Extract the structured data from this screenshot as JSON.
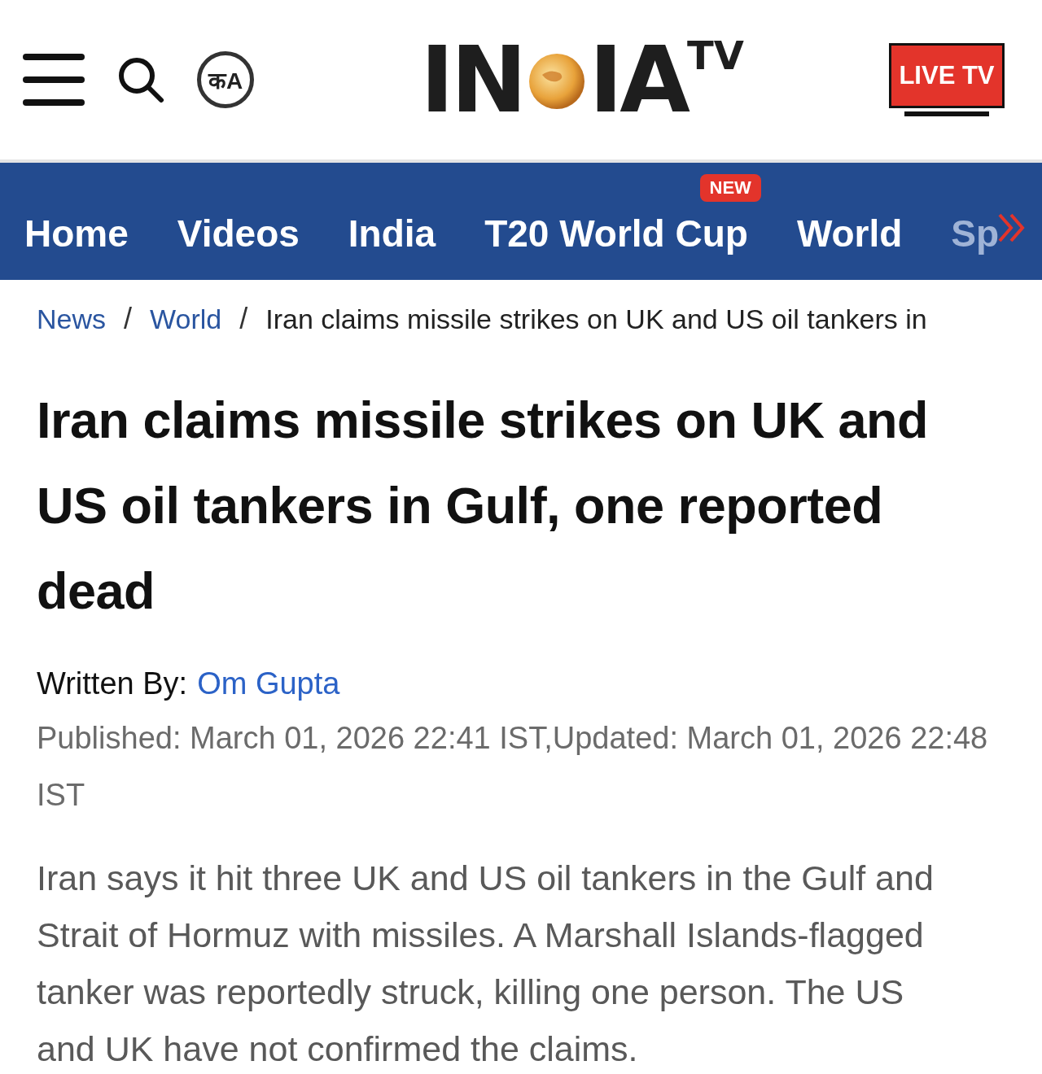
{
  "header": {
    "language_toggle": "कA",
    "logo": {
      "before": "IN",
      "after": "IA",
      "super": "TV"
    },
    "live_button": "LIVE TV"
  },
  "nav": [
    {
      "label": "Home",
      "cut": false
    },
    {
      "label": "Videos",
      "cut": false
    },
    {
      "label": "India",
      "cut": false
    },
    {
      "label": "T20 World Cup",
      "badge": "NEW",
      "cut": false
    },
    {
      "label": "World",
      "cut": false
    },
    {
      "label": "Sp",
      "cut": true
    }
  ],
  "breadcrumb": [
    {
      "label": "News",
      "kind": "link"
    },
    {
      "label": "/",
      "kind": "separator"
    },
    {
      "label": "World",
      "kind": "link"
    },
    {
      "label": "/",
      "kind": "separator"
    },
    {
      "label": "Iran claims missile strikes on UK and US oil tankers in",
      "kind": "current"
    }
  ],
  "article": {
    "title": "Iran claims missile strikes on UK and US oil tankers in Gulf, one reported dead",
    "byline_label": "Written By:",
    "author": "Om Gupta",
    "published": "Published: March 01, 2026 22:41 IST,Updated: March 01, 2026 22:48 IST",
    "summary": "Iran says it hit three UK and US oil tankers in the Gulf and Strait of Hormuz with missiles. A Marshall Islands-flagged tanker was reportedly struck, killing one person. The US and UK have not confirmed the claims."
  }
}
